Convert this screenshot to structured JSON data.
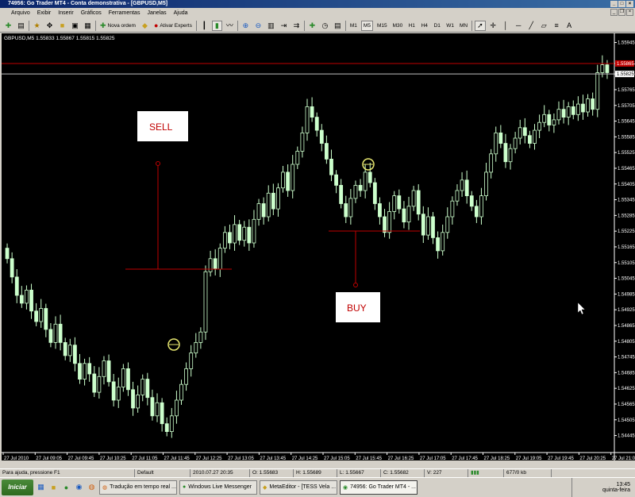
{
  "window": {
    "title": "74956: Go Trader MT4 - Conta demonstrativa - [GBPUSD,M5]"
  },
  "menu": [
    "Arquivo",
    "Exibir",
    "Inserir",
    "Gráficos",
    "Ferramentas",
    "Janelas",
    "Ajuda"
  ],
  "toolbar": {
    "new_order": "Nova ordem",
    "experts": "Ativar Experts",
    "periods": [
      "M1",
      "M5",
      "M15",
      "M30",
      "H1",
      "H4",
      "D1",
      "W1",
      "MN"
    ],
    "active_period": "M5"
  },
  "chart": {
    "header": "GBPUSD,M5  1.55833 1.55867 1.55815 1.55825",
    "price_labels": [
      "1.55945",
      "1.55865",
      "1.55825",
      "1.55765",
      "1.55705",
      "1.55645",
      "1.55585",
      "1.55525",
      "1.55465",
      "1.55405",
      "1.55345",
      "1.55285",
      "1.55225",
      "1.55165",
      "1.55105",
      "1.55045",
      "1.54985",
      "1.54925",
      "1.54865",
      "1.54805",
      "1.54745",
      "1.54685",
      "1.54625",
      "1.54565",
      "1.54505",
      "1.54445",
      "1.54385"
    ],
    "current_price": "1.55825",
    "red_price_label": "1.55865",
    "time_labels": [
      "27 Jul 2010",
      "27 Jul 09:05",
      "27 Jul 09:45",
      "27 Jul 10:25",
      "27 Jul 11:05",
      "27 Jul 11:45",
      "27 Jul 12:25",
      "27 Jul 13:05",
      "27 Jul 13:45",
      "27 Jul 14:25",
      "27 Jul 15:05",
      "27 Jul 15:45",
      "27 Jul 16:25",
      "27 Jul 17:05",
      "27 Jul 17:45",
      "27 Jul 18:25",
      "27 Jul 19:05",
      "27 Jul 19:45",
      "27 Jul 20:25",
      "27 Jul 21:05"
    ],
    "annotations": {
      "sell": "SELL",
      "buy": "BUY"
    },
    "colors": {
      "background": "#000000",
      "candle_up": "#ccffcc",
      "candle_down": "#ccffcc",
      "annotation_line": "#c00000",
      "bid_line": "#c0c0c0",
      "marker": "#e8e870"
    }
  },
  "chart_data": {
    "type": "candlestick",
    "symbol": "GBPUSD",
    "timeframe": "M5",
    "ylim": [
      1.5438,
      1.5598
    ],
    "close_series": [
      1.5512,
      1.5505,
      1.5498,
      1.5495,
      1.55,
      1.5492,
      1.5488,
      1.5493,
      1.5485,
      1.548,
      1.5487,
      1.548,
      1.5475,
      1.5479,
      1.5472,
      1.5466,
      1.5472,
      1.5468,
      1.5461,
      1.5467,
      1.5473,
      1.5465,
      1.5458,
      1.5463,
      1.547,
      1.5462,
      1.5455,
      1.546,
      1.5466,
      1.5459,
      1.5452,
      1.5457,
      1.5449,
      1.5446,
      1.5452,
      1.5458,
      1.5464,
      1.547,
      1.5476,
      1.548,
      1.5484,
      1.5507,
      1.5512,
      1.5508,
      1.5516,
      1.5522,
      1.5518,
      1.5525,
      1.5519,
      1.5524,
      1.5518,
      1.5527,
      1.5533,
      1.5528,
      1.5537,
      1.5531,
      1.5539,
      1.5545,
      1.5538,
      1.5548,
      1.5553,
      1.556,
      1.557,
      1.5566,
      1.5561,
      1.5556,
      1.555,
      1.5544,
      1.554,
      1.5533,
      1.5528,
      1.5535,
      1.554,
      1.5538,
      1.5545,
      1.5541,
      1.5533,
      1.5528,
      1.5522,
      1.553,
      1.5536,
      1.5531,
      1.5526,
      1.5532,
      1.5538,
      1.5529,
      1.5521,
      1.5528,
      1.552,
      1.5515,
      1.5522,
      1.5528,
      1.5534,
      1.5538,
      1.5542,
      1.5536,
      1.5532,
      1.5528,
      1.5536,
      1.5545,
      1.5552,
      1.556,
      1.5556,
      1.5549,
      1.5554,
      1.5558,
      1.5562,
      1.5559,
      1.5556,
      1.5561,
      1.5564,
      1.5567,
      1.5563,
      1.5565,
      1.5569,
      1.5566,
      1.557,
      1.5567,
      1.5571,
      1.5568,
      1.5573,
      1.5569,
      1.5583,
      1.5586,
      1.5583
    ]
  },
  "status": {
    "help": "Para ajuda, pressione F1",
    "profile": "Default",
    "datetime": "2010.07.27 20:35",
    "open": "O: 1.55683",
    "high": "H: 1.55689",
    "low": "L: 1.55667",
    "close": "C: 1.55682",
    "volume": "V: 227",
    "traffic": "677/0 kb"
  },
  "taskbar": {
    "start": "Iniciar",
    "tasks": [
      "Tradução em tempo real ...",
      "Windows Live Messenger",
      "MetaEditor - [TESS Vela ...",
      "74956: Go Trader MT4 - ..."
    ],
    "clock": "13:45",
    "day": "quinta-feira"
  }
}
